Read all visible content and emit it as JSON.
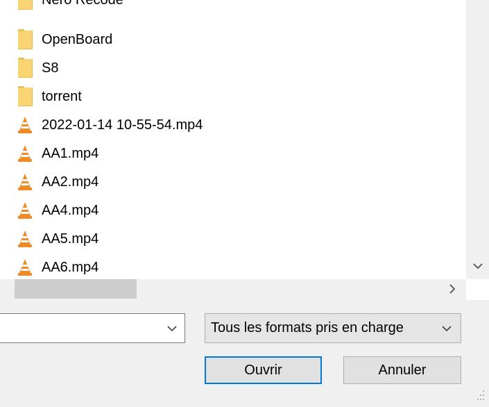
{
  "file_list": [
    {
      "name": "Nero Recode",
      "type": "folder",
      "icon": "folder-icon"
    },
    {
      "name": "OpenBoard",
      "type": "folder",
      "icon": "folder-icon"
    },
    {
      "name": "S8",
      "type": "folder",
      "icon": "folder-icon"
    },
    {
      "name": "torrent",
      "type": "folder",
      "icon": "folder-icon"
    },
    {
      "name": "2022-01-14 10-55-54.mp4",
      "type": "video",
      "icon": "vlc-cone-icon"
    },
    {
      "name": "AA1.mp4",
      "type": "video",
      "icon": "vlc-cone-icon"
    },
    {
      "name": "AA2.mp4",
      "type": "video",
      "icon": "vlc-cone-icon"
    },
    {
      "name": "AA4.mp4",
      "type": "video",
      "icon": "vlc-cone-icon"
    },
    {
      "name": "AA5.mp4",
      "type": "video",
      "icon": "vlc-cone-icon"
    },
    {
      "name": "AA6.mp4",
      "type": "video",
      "icon": "vlc-cone-icon"
    }
  ],
  "filename_combo": {
    "value": ""
  },
  "filetype_select": {
    "selected": "Tous les formats pris en charge"
  },
  "buttons": {
    "open": "Ouvrir",
    "cancel": "Annuler"
  },
  "colors": {
    "folder": "#f8d572",
    "vlc_orange": "#f08a24",
    "focus_border": "#0078d7"
  }
}
